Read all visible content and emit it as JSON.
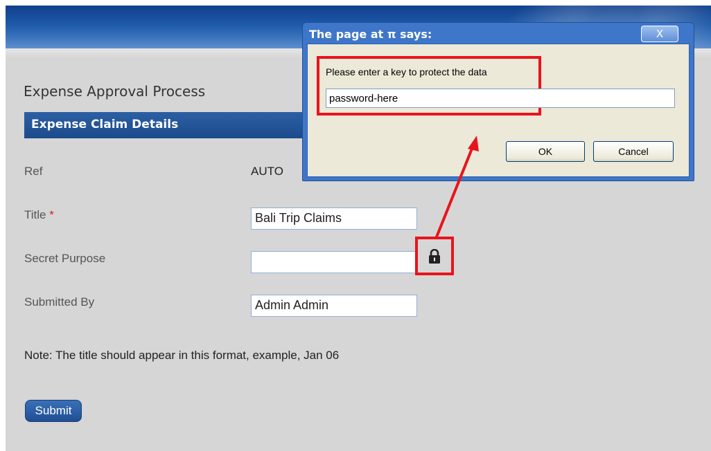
{
  "page": {
    "title": "Expense Approval Process",
    "section_title": "Expense Claim Details"
  },
  "form": {
    "ref_label": "Ref",
    "ref_value": "AUTO",
    "title_label": "Title",
    "title_required_marker": "*",
    "title_value": "Bali Trip Claims",
    "secret_purpose_label": "Secret Purpose",
    "secret_purpose_value": "",
    "submitted_by_label": "Submitted By",
    "submitted_by_value": "Admin Admin",
    "note": "Note: The title should appear in this format, example, Jan 06",
    "submit_label": "Submit",
    "lock_icon": "lock-icon"
  },
  "dialog": {
    "title": "The page at π says:",
    "close_label": "X",
    "prompt": "Please enter a key to protect the data",
    "input_value": "password-here",
    "ok_label": "OK",
    "cancel_label": "Cancel"
  },
  "colors": {
    "highlight": "#e8141c",
    "header_blue": "#1c4b8c",
    "dialog_blue": "#3e76c9"
  }
}
